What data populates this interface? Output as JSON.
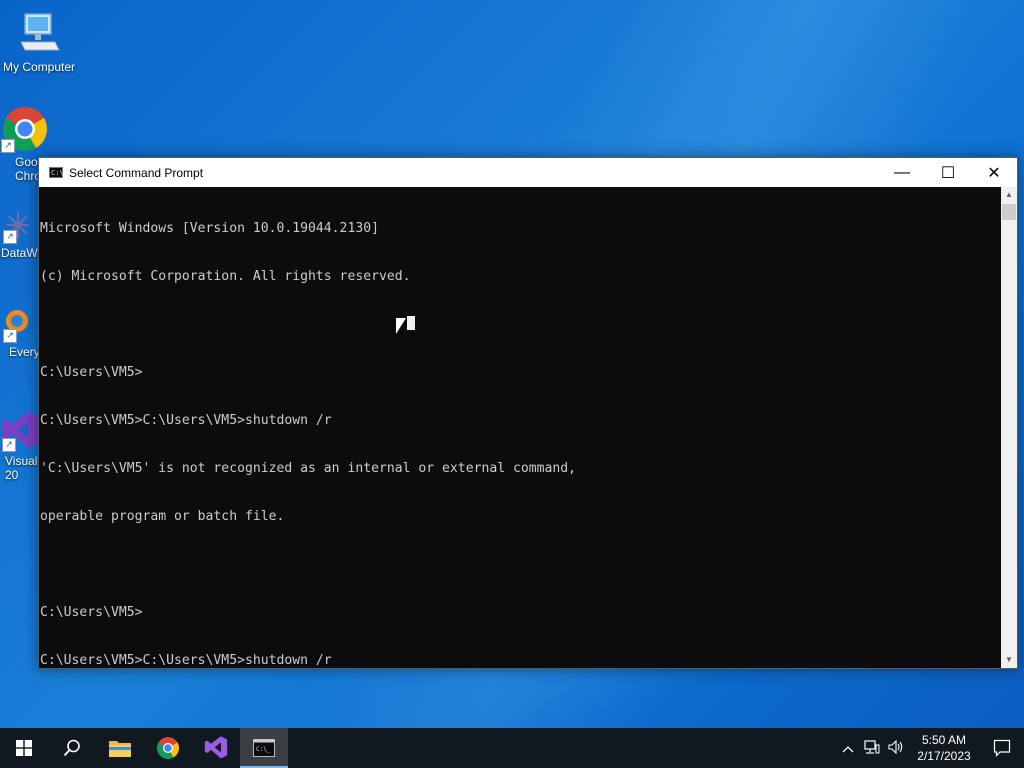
{
  "desktop": {
    "icons": [
      {
        "label": "My Computer"
      },
      {
        "label": "Goo\nChro"
      },
      {
        "label": "DataW"
      },
      {
        "label": "Every"
      },
      {
        "label": "Visual\n20"
      }
    ]
  },
  "window": {
    "title": "Select Command Prompt",
    "minimize_glyph": "—",
    "maximize_glyph": "☐",
    "close_glyph": "✕",
    "console_lines": [
      "Microsoft Windows [Version 10.0.19044.2130]",
      "(c) Microsoft Corporation. All rights reserved.",
      "",
      "C:\\Users\\VM5>",
      "C:\\Users\\VM5>C:\\Users\\VM5>shutdown /r",
      "'C:\\Users\\VM5' is not recognized as an internal or external command,",
      "operable program or batch file.",
      "",
      "C:\\Users\\VM5>",
      "C:\\Users\\VM5>C:\\Users\\VM5>shutdown /r"
    ]
  },
  "taskbar": {
    "items": [
      "start-icon",
      "search-icon",
      "file-explorer-icon",
      "chrome-icon",
      "visual-studio-icon",
      "command-prompt-icon"
    ],
    "clock_time": "5:50 AM",
    "clock_date": "2/17/2023"
  }
}
